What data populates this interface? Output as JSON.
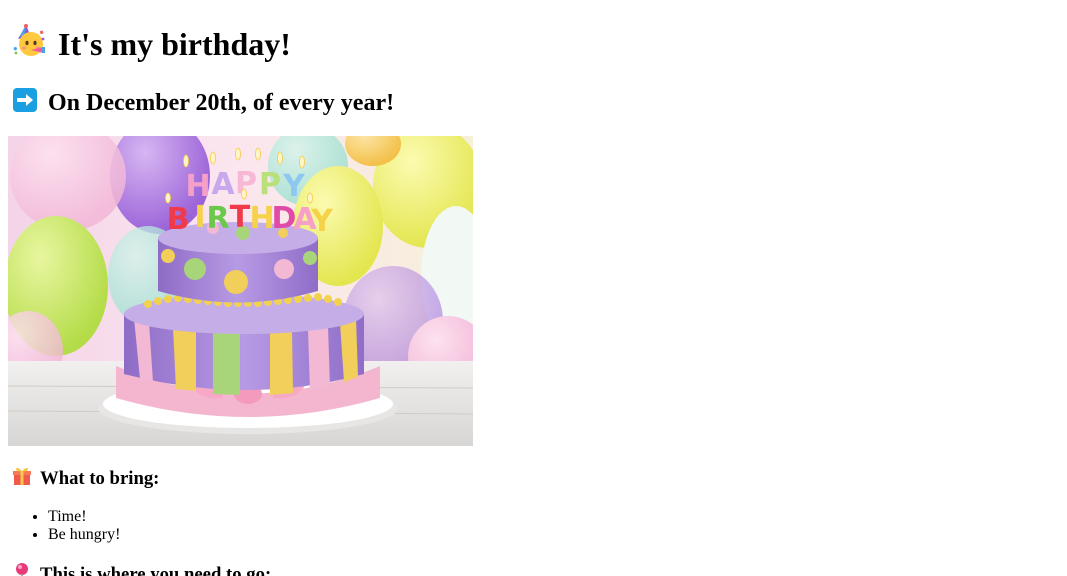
{
  "header": {
    "title": "It's my birthday!",
    "title_icon": "party-face-icon"
  },
  "subheader": {
    "text": "On December 20th, of every year!",
    "icon": "right-arrow-icon"
  },
  "cake_image": {
    "letters_top": "HAPPY",
    "letters_bottom": "BIRTHDAY"
  },
  "bring_section": {
    "heading": "What to bring:",
    "icon": "gift-icon",
    "items": [
      "Time!",
      "Be hungry!"
    ]
  },
  "location_section": {
    "heading": "This is where you need to go:",
    "icon": "map-pin-icon"
  },
  "colors": {
    "arrow_blue": "#1a9fe0",
    "cake_purple": "#a98ad8",
    "cake_pink": "#f3b8d2",
    "ribbon_yellow": "#f2d24c",
    "ribbon_green": "#a8d47a"
  }
}
